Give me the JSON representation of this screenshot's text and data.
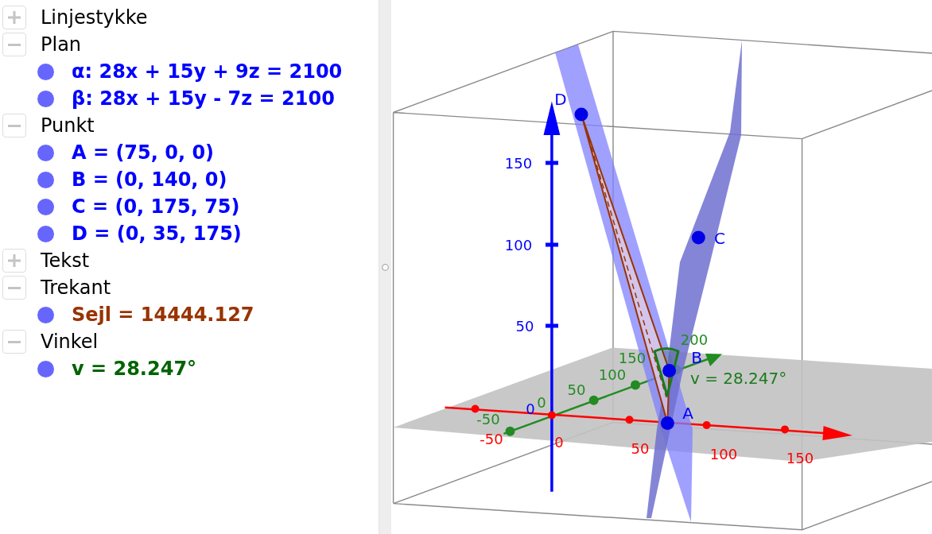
{
  "algebra_view": {
    "groups": [
      {
        "label": "Linjestykke",
        "expanded": false
      },
      {
        "label": "Plan",
        "expanded": true,
        "items": [
          {
            "text": "α: 28x + 15y + 9z = 2100",
            "color": "#0000ff",
            "visible": true
          },
          {
            "text": "β: 28x + 15y - 7z = 2100",
            "color": "#0000ff",
            "visible": true
          }
        ]
      },
      {
        "label": "Punkt",
        "expanded": true,
        "items": [
          {
            "text": "A = (75, 0, 0)",
            "color": "#0000ff",
            "visible": true
          },
          {
            "text": "B = (0, 140, 0)",
            "color": "#0000ff",
            "visible": true
          },
          {
            "text": "C = (0, 175, 75)",
            "color": "#0000ff",
            "visible": true
          },
          {
            "text": "D = (0, 35, 175)",
            "color": "#0000ff",
            "visible": true
          }
        ]
      },
      {
        "label": "Tekst",
        "expanded": false
      },
      {
        "label": "Trekant",
        "expanded": true,
        "items": [
          {
            "text": "Sejl = 14444.127",
            "color": "#993300",
            "visible": true
          }
        ]
      },
      {
        "label": "Vinkel",
        "expanded": true,
        "items": [
          {
            "text": "v = 28.247°",
            "color": "#006400",
            "visible": true
          }
        ]
      }
    ]
  },
  "graphics_3d": {
    "axes": [
      {
        "kind": "z",
        "color": "#0000ff",
        "tick_labels": [
          "150",
          "100",
          "50",
          "0"
        ]
      },
      {
        "kind": "y",
        "color": "#228b22",
        "tick_labels": [
          "-50",
          "0",
          "50",
          "100",
          "150",
          "200"
        ]
      },
      {
        "kind": "x",
        "color": "#ff0000",
        "tick_labels": [
          "-50",
          "0",
          "50",
          "100",
          "150"
        ]
      }
    ],
    "points": [
      {
        "label": "D"
      },
      {
        "label": "C"
      },
      {
        "label": "B"
      },
      {
        "label": "A"
      }
    ],
    "angle_label": "v = 28.247°"
  }
}
